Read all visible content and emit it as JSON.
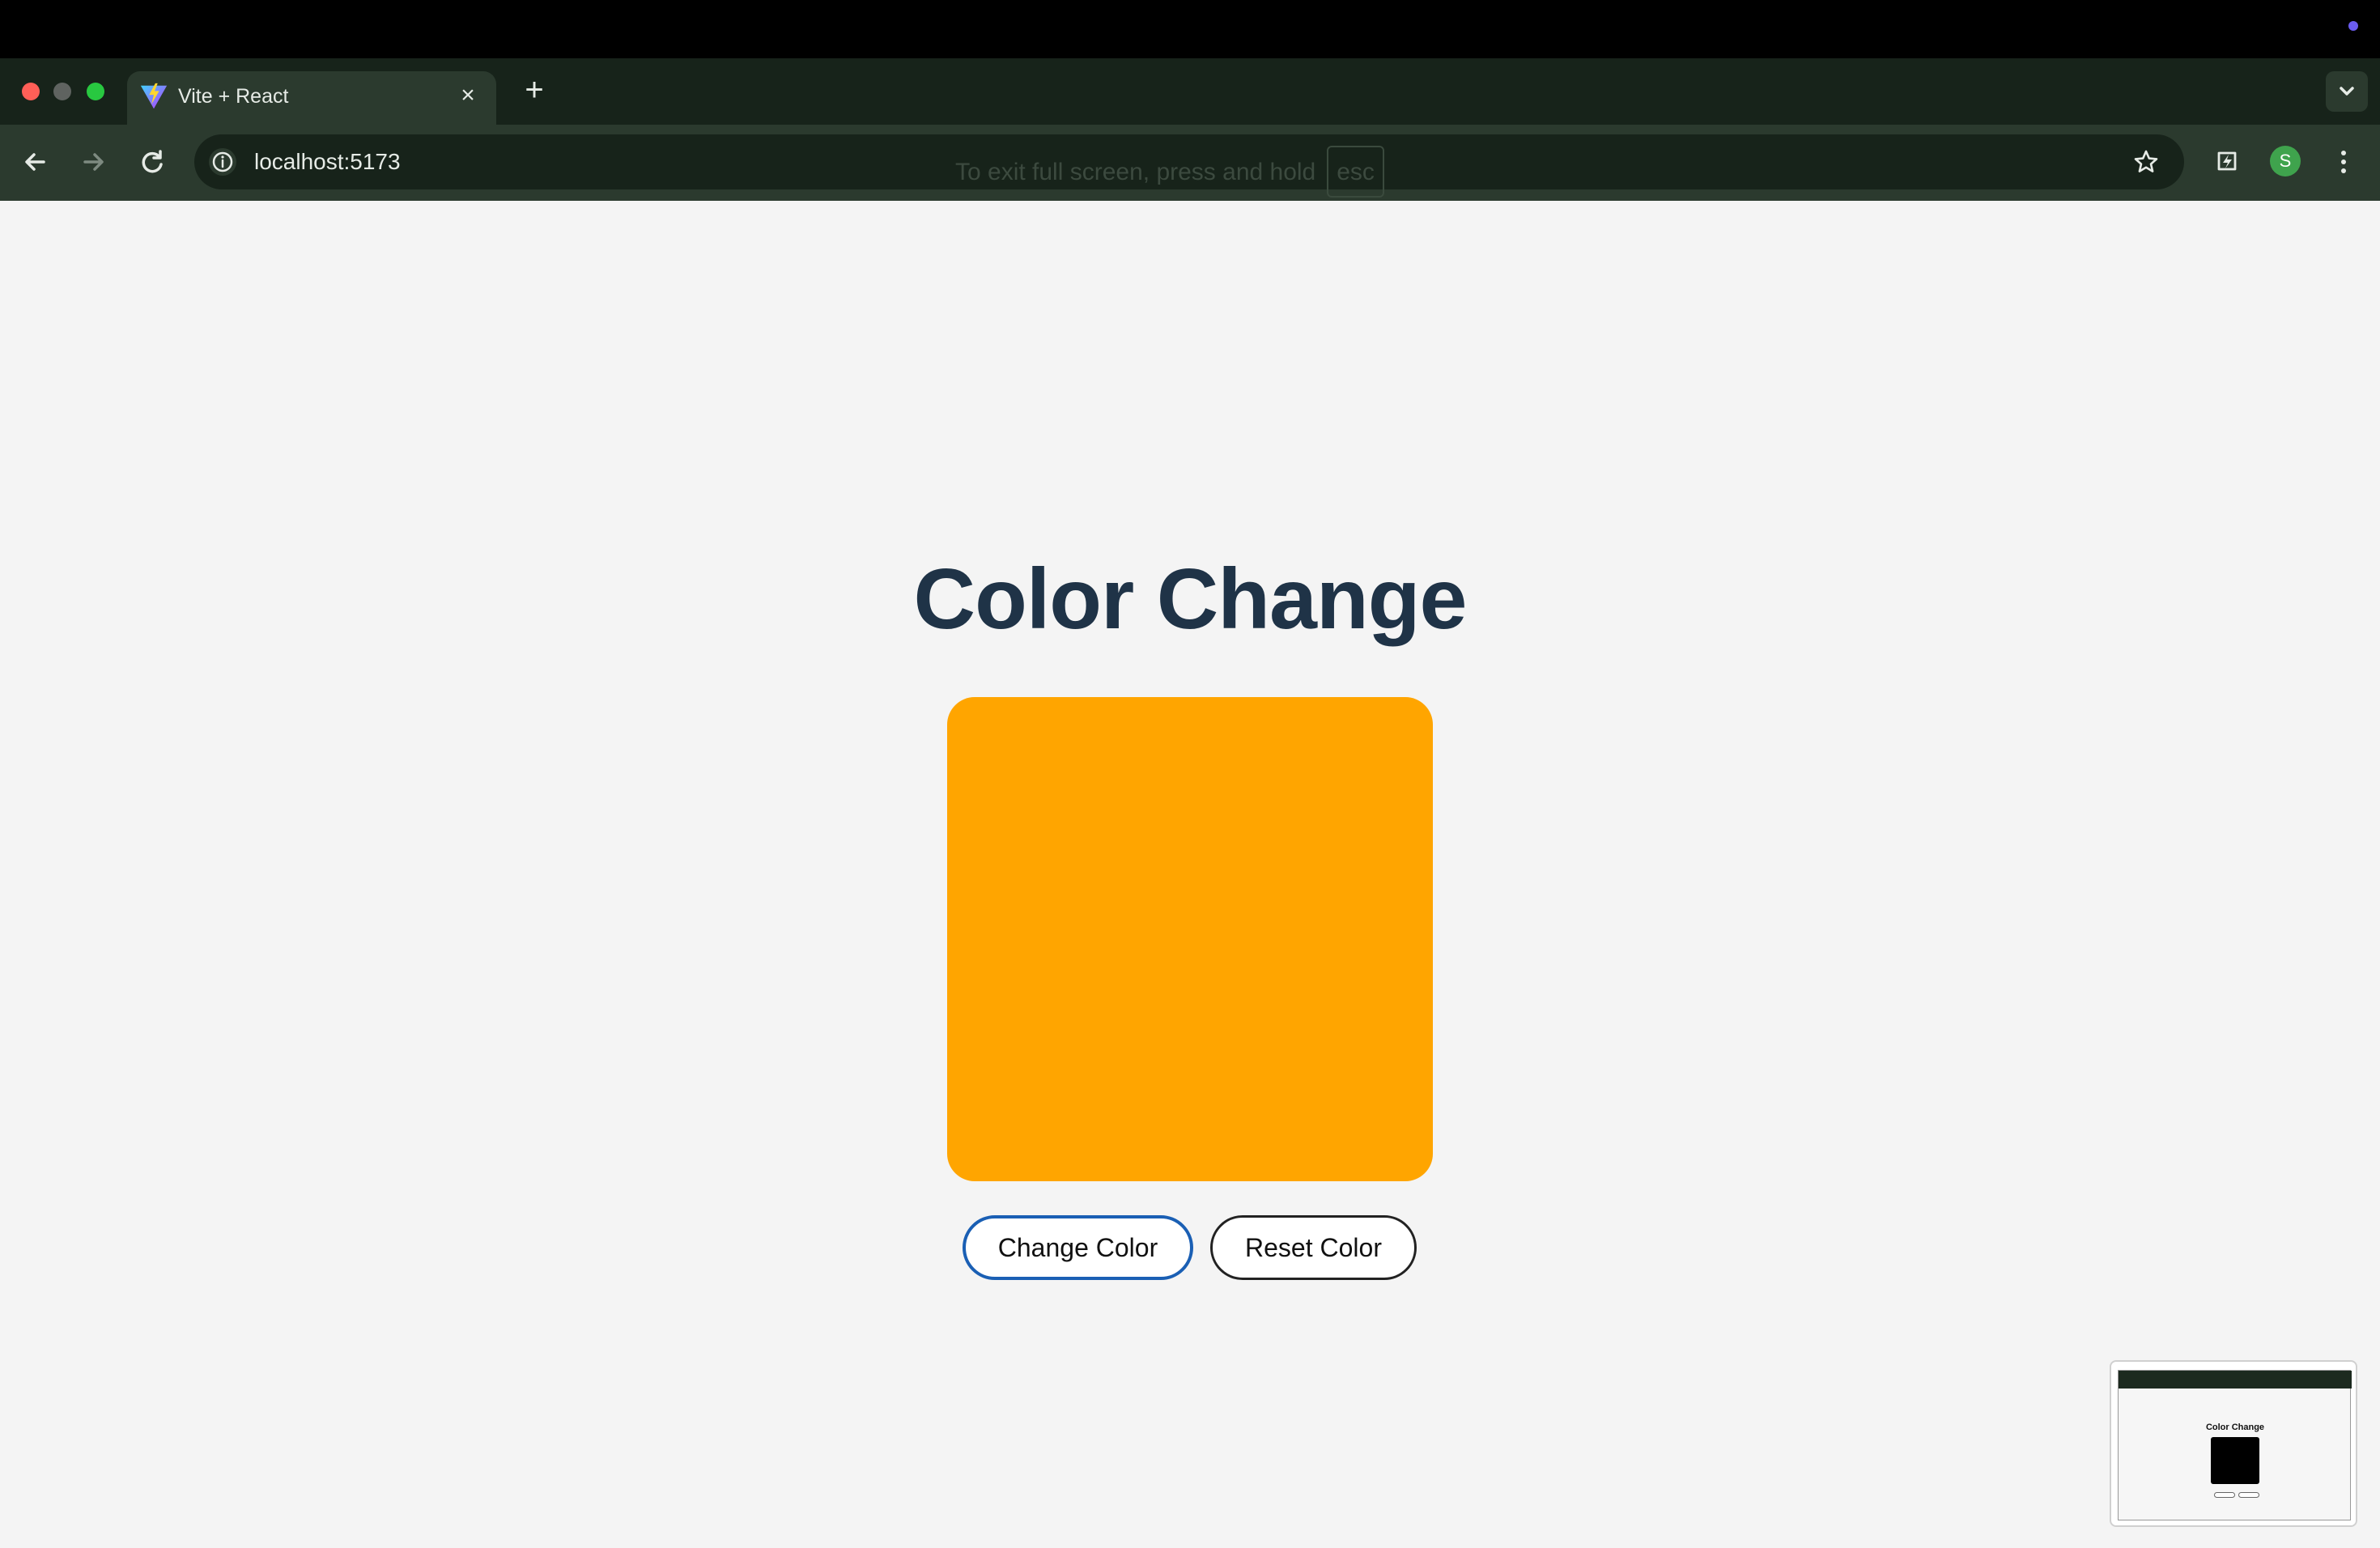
{
  "browser": {
    "tab": {
      "title": "Vite + React",
      "close_glyph": "×",
      "favicon": "vite-logo-icon"
    },
    "new_tab_glyph": "+",
    "address_bar": {
      "url": "localhost:5173"
    },
    "profile_initial": "S",
    "fullscreen_hint": {
      "text": "To exit full screen, press and hold",
      "key": "esc"
    }
  },
  "page": {
    "title": "Color Change",
    "box_color": "#ffa500",
    "buttons": {
      "change": "Change Color",
      "reset": "Reset Color"
    }
  },
  "thumbnail": {
    "title": "Color Change",
    "box_color": "#000000"
  },
  "colors": {
    "title_text": "#1f3347",
    "focus_ring": "#1a5fb4",
    "page_bg": "#f4f4f4"
  }
}
